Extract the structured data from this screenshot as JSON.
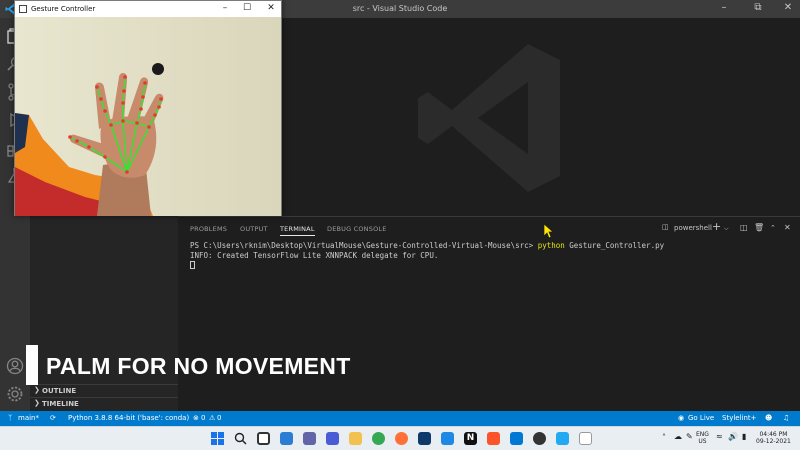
{
  "window": {
    "title": "src - Visual Studio Code"
  },
  "sidebar": {
    "sections": [
      {
        "label": "OUTLINE"
      },
      {
        "label": "TIMELINE"
      }
    ]
  },
  "panel": {
    "tabs": [
      {
        "label": "PROBLEMS"
      },
      {
        "label": "OUTPUT"
      },
      {
        "label": "TERMINAL"
      },
      {
        "label": "DEBUG CONSOLE"
      }
    ],
    "active_tab": "TERMINAL",
    "shell_label": "powershell",
    "terminal": {
      "prompt": "PS C:\\Users\\rknim\\Desktop\\VirtualMouse\\Gesture-Controlled-Virtual-Mouse\\src> ",
      "command": "python",
      "args": " Gesture_Controller.py",
      "output": "INFO: Created TensorFlow Lite XNNPACK delegate for CPU."
    }
  },
  "statusbar": {
    "branch": "main*",
    "interpreter": "Python 3.8.8 64-bit ('base': conda)",
    "errors": "0",
    "warnings": "0",
    "golive": "Go Live",
    "stylelint": "Stylelint+"
  },
  "gesture_window": {
    "title": "Gesture Controller"
  },
  "caption": {
    "text": "PALM FOR NO MOVEMENT"
  },
  "taskbar": {
    "language": "ENG",
    "region": "US",
    "time": "04:46 PM",
    "date": "09-12-2021"
  },
  "colors": {
    "accent": "#007acc",
    "terminal_command": "#e5e510",
    "landmark_red": "#e53935",
    "landmark_green": "#2ee82e"
  }
}
